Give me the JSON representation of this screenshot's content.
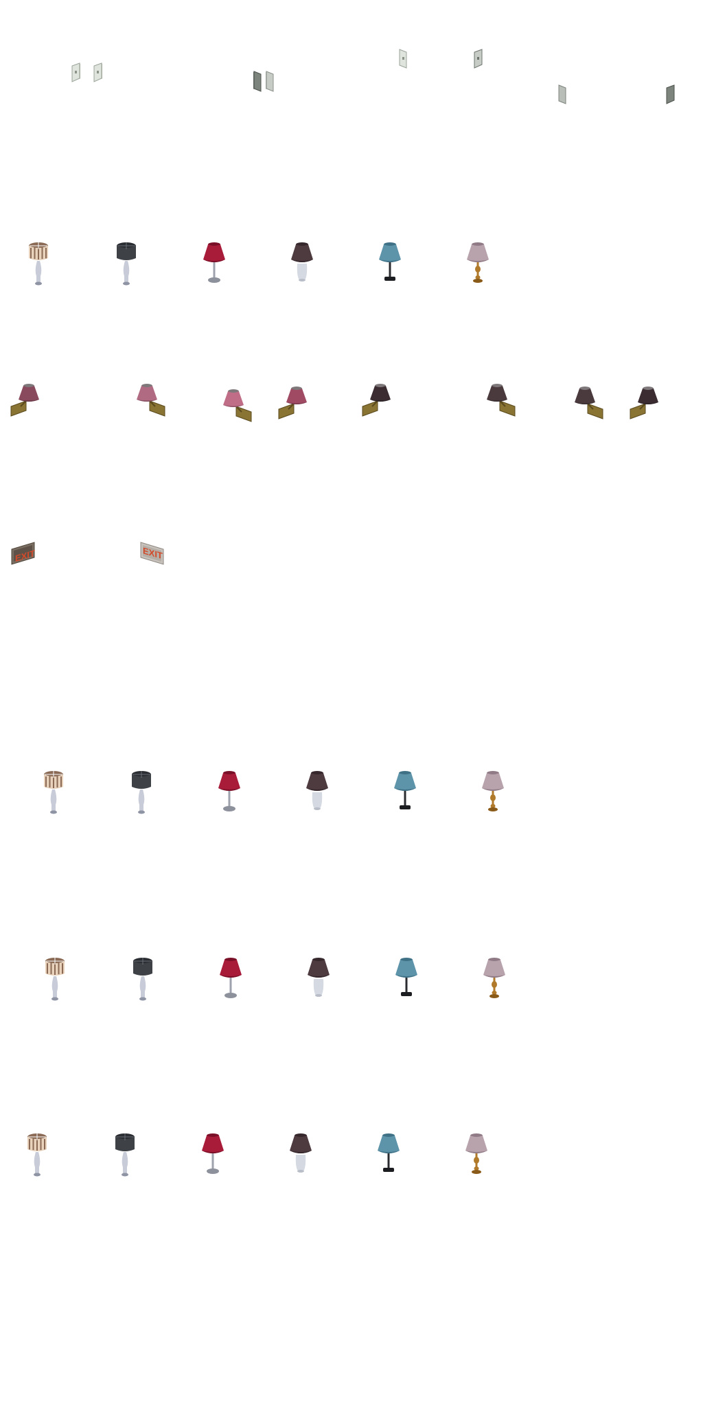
{
  "sheet": {
    "switch_rows": [
      {
        "items": [
          {
            "kind": "light-switch",
            "facing": "left",
            "tone": "light"
          },
          {
            "kind": "light-switch",
            "facing": "left",
            "tone": "light"
          },
          {
            "kind": "light-switch",
            "facing": "right",
            "tone": "dark"
          },
          {
            "kind": "light-switch",
            "facing": "right",
            "tone": "light"
          },
          {
            "kind": "light-switch",
            "facing": "left",
            "tone": "light"
          },
          {
            "kind": "light-switch",
            "facing": "right",
            "tone": "dark"
          },
          {
            "kind": "light-switch",
            "facing": "left",
            "tone": "light"
          },
          {
            "kind": "light-switch",
            "facing": "right",
            "tone": "dark"
          }
        ]
      }
    ],
    "lamp_palette": [
      {
        "style": "drum-striped",
        "shade": "#e8d2bc",
        "stripe": "#8a6a55",
        "base": "#c8ccd8",
        "foot": "#8f94a4"
      },
      {
        "style": "drum-dark",
        "shade": "#3e4247",
        "stripe": "#2a2d31",
        "base": "#c8ccd8",
        "foot": "#8f94a4"
      },
      {
        "style": "cone-red",
        "shade": "#a81c3a",
        "stripe": "#7a1027",
        "base": "#9ea2ac",
        "foot": "#8d919c"
      },
      {
        "style": "cone-brown",
        "shade": "#4e3b40",
        "stripe": "#35272b",
        "base": "#d4d9e2",
        "foot": "#b8bdc8"
      },
      {
        "style": "cone-teal",
        "shade": "#5e94aa",
        "stripe": "#3f7186",
        "base": "#2a2c30",
        "foot": "#1c1d20"
      },
      {
        "style": "cone-mauve",
        "shade": "#b8a3ad",
        "stripe": "#8f7a85",
        "base": "#b07a2a",
        "foot": "#8a5a18"
      }
    ],
    "table_lamp_rows": [
      {
        "row": 1
      },
      {
        "row": 2
      },
      {
        "row": 3
      },
      {
        "row": 4
      }
    ],
    "sconce_row": {
      "items": [
        {
          "kind": "wall-sconce",
          "shade": "#8a4a5e",
          "facing": "left"
        },
        {
          "kind": "wall-sconce",
          "shade": "#b06a82",
          "facing": "right"
        },
        {
          "kind": "wall-sconce",
          "shade": "#c06e88",
          "facing": "right"
        },
        {
          "kind": "wall-sconce",
          "shade": "#a04a64",
          "facing": "left"
        },
        {
          "kind": "wall-sconce",
          "shade": "#3a2c30",
          "facing": "left"
        },
        {
          "kind": "wall-sconce",
          "shade": "#4a3a3e",
          "facing": "right"
        },
        {
          "kind": "wall-sconce",
          "shade": "#4a3a3e",
          "facing": "right"
        },
        {
          "kind": "wall-sconce",
          "shade": "#3a2c30",
          "facing": "left"
        }
      ],
      "plate_color": "#8a7434"
    },
    "exit_signs": [
      {
        "label": "EXIT",
        "facing": "left",
        "frame": "#7a6e62",
        "text_color": "#d24a2a"
      },
      {
        "label": "EXIT",
        "facing": "right",
        "frame": "#c8c2bc",
        "text_color": "#d24a2a"
      }
    ]
  }
}
